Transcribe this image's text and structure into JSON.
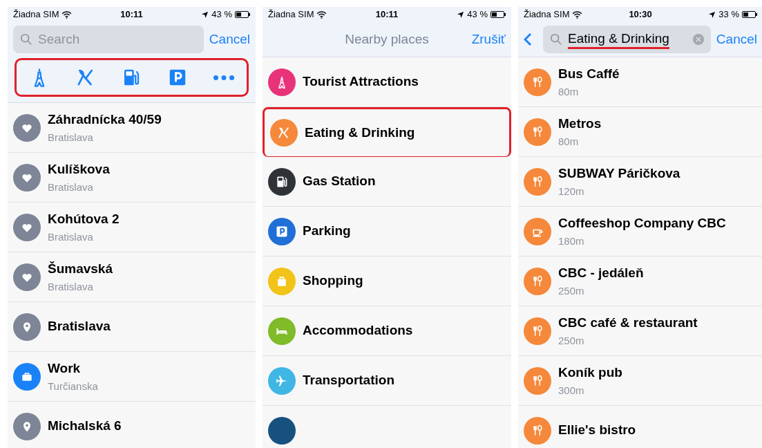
{
  "screens": [
    {
      "kind": "search",
      "status_bar": {
        "carrier": "Žiadna SIM",
        "time": "10:11",
        "battery": "43 %"
      },
      "search": {
        "placeholder": "Search"
      },
      "cancel": "Cancel",
      "category_bar": {
        "highlighted": true,
        "categories": [
          {
            "kind": "attraction"
          },
          {
            "kind": "food"
          },
          {
            "kind": "fuel"
          },
          {
            "kind": "parking"
          },
          {
            "kind": "more"
          }
        ]
      },
      "items": [
        {
          "kind": "favorite",
          "title": "Záhradnícka 40/59",
          "subtitle": "Bratislava",
          "color": "#7d8596",
          "highlighted": false
        },
        {
          "kind": "favorite",
          "title": "Kulíškova",
          "subtitle": "Bratislava",
          "color": "#7d8596",
          "highlighted": false
        },
        {
          "kind": "favorite",
          "title": "Kohútova 2",
          "subtitle": "Bratislava",
          "color": "#7d8596",
          "highlighted": false
        },
        {
          "kind": "favorite",
          "title": "Šumavská",
          "subtitle": "Bratislava",
          "color": "#7d8596",
          "highlighted": false
        },
        {
          "kind": "pin",
          "title": "Bratislava",
          "color": "#7d8596",
          "highlighted": false
        },
        {
          "kind": "work",
          "title": "Work",
          "subtitle": "Turčianska",
          "color": "#1a82f7",
          "highlighted": false
        },
        {
          "kind": "pin",
          "title": "Michalská 6",
          "color": "#7d8596",
          "highlighted": false
        }
      ]
    },
    {
      "kind": "categories",
      "status_bar": {
        "carrier": "Žiadna SIM",
        "time": "10:11",
        "battery": "43 %"
      },
      "title": "Nearby places",
      "cancel": "Zrušiť",
      "items": [
        {
          "kind": "attraction",
          "title": "Tourist Attractions",
          "color": "#e8337a",
          "highlighted": false
        },
        {
          "kind": "food",
          "title": "Eating & Drinking",
          "color": "#f5883a",
          "highlighted": true
        },
        {
          "kind": "fuel",
          "title": "Gas Station",
          "color": "#2f3237",
          "highlighted": false
        },
        {
          "kind": "parking",
          "title": "Parking",
          "color": "#1f6fd6",
          "highlighted": false
        },
        {
          "kind": "shopping",
          "title": "Shopping",
          "color": "#f2c318",
          "highlighted": false
        },
        {
          "kind": "bed",
          "title": "Accommodations",
          "color": "#80bb2a",
          "highlighted": false
        },
        {
          "kind": "plane",
          "title": "Transportation",
          "color": "#3fb6e4",
          "highlighted": false
        },
        {
          "kind": "none",
          "color": "#17527e",
          "highlighted": false
        }
      ]
    },
    {
      "kind": "results",
      "status_bar": {
        "carrier": "Žiadna SIM",
        "time": "10:30",
        "battery": "33 %"
      },
      "search": {
        "value": "Eating & Drinking",
        "underlined": true
      },
      "cancel": "Cancel",
      "items": [
        {
          "kind": "food",
          "title": "Bus Caffé",
          "subtitle": "80m",
          "color": "#f5883a",
          "highlighted": false
        },
        {
          "kind": "food",
          "title": "Metros",
          "subtitle": "80m",
          "color": "#f5883a",
          "highlighted": false
        },
        {
          "kind": "food",
          "title": "SUBWAY Páričkova",
          "subtitle": "120m",
          "color": "#f5883a",
          "highlighted": false
        },
        {
          "kind": "cup",
          "title": "Coffeeshop Company CBC",
          "subtitle": "180m",
          "color": "#f5883a",
          "highlighted": false
        },
        {
          "kind": "food",
          "title": "CBC - jedáleň",
          "subtitle": "250m",
          "color": "#f5883a",
          "highlighted": false
        },
        {
          "kind": "food",
          "title": "CBC café & restaurant",
          "subtitle": "250m",
          "color": "#f5883a",
          "highlighted": false
        },
        {
          "kind": "food",
          "title": "Koník pub",
          "subtitle": "300m",
          "color": "#f5883a",
          "highlighted": false
        },
        {
          "kind": "food",
          "title": "Ellie's bistro",
          "color": "#f5883a",
          "highlighted": false
        }
      ]
    }
  ]
}
